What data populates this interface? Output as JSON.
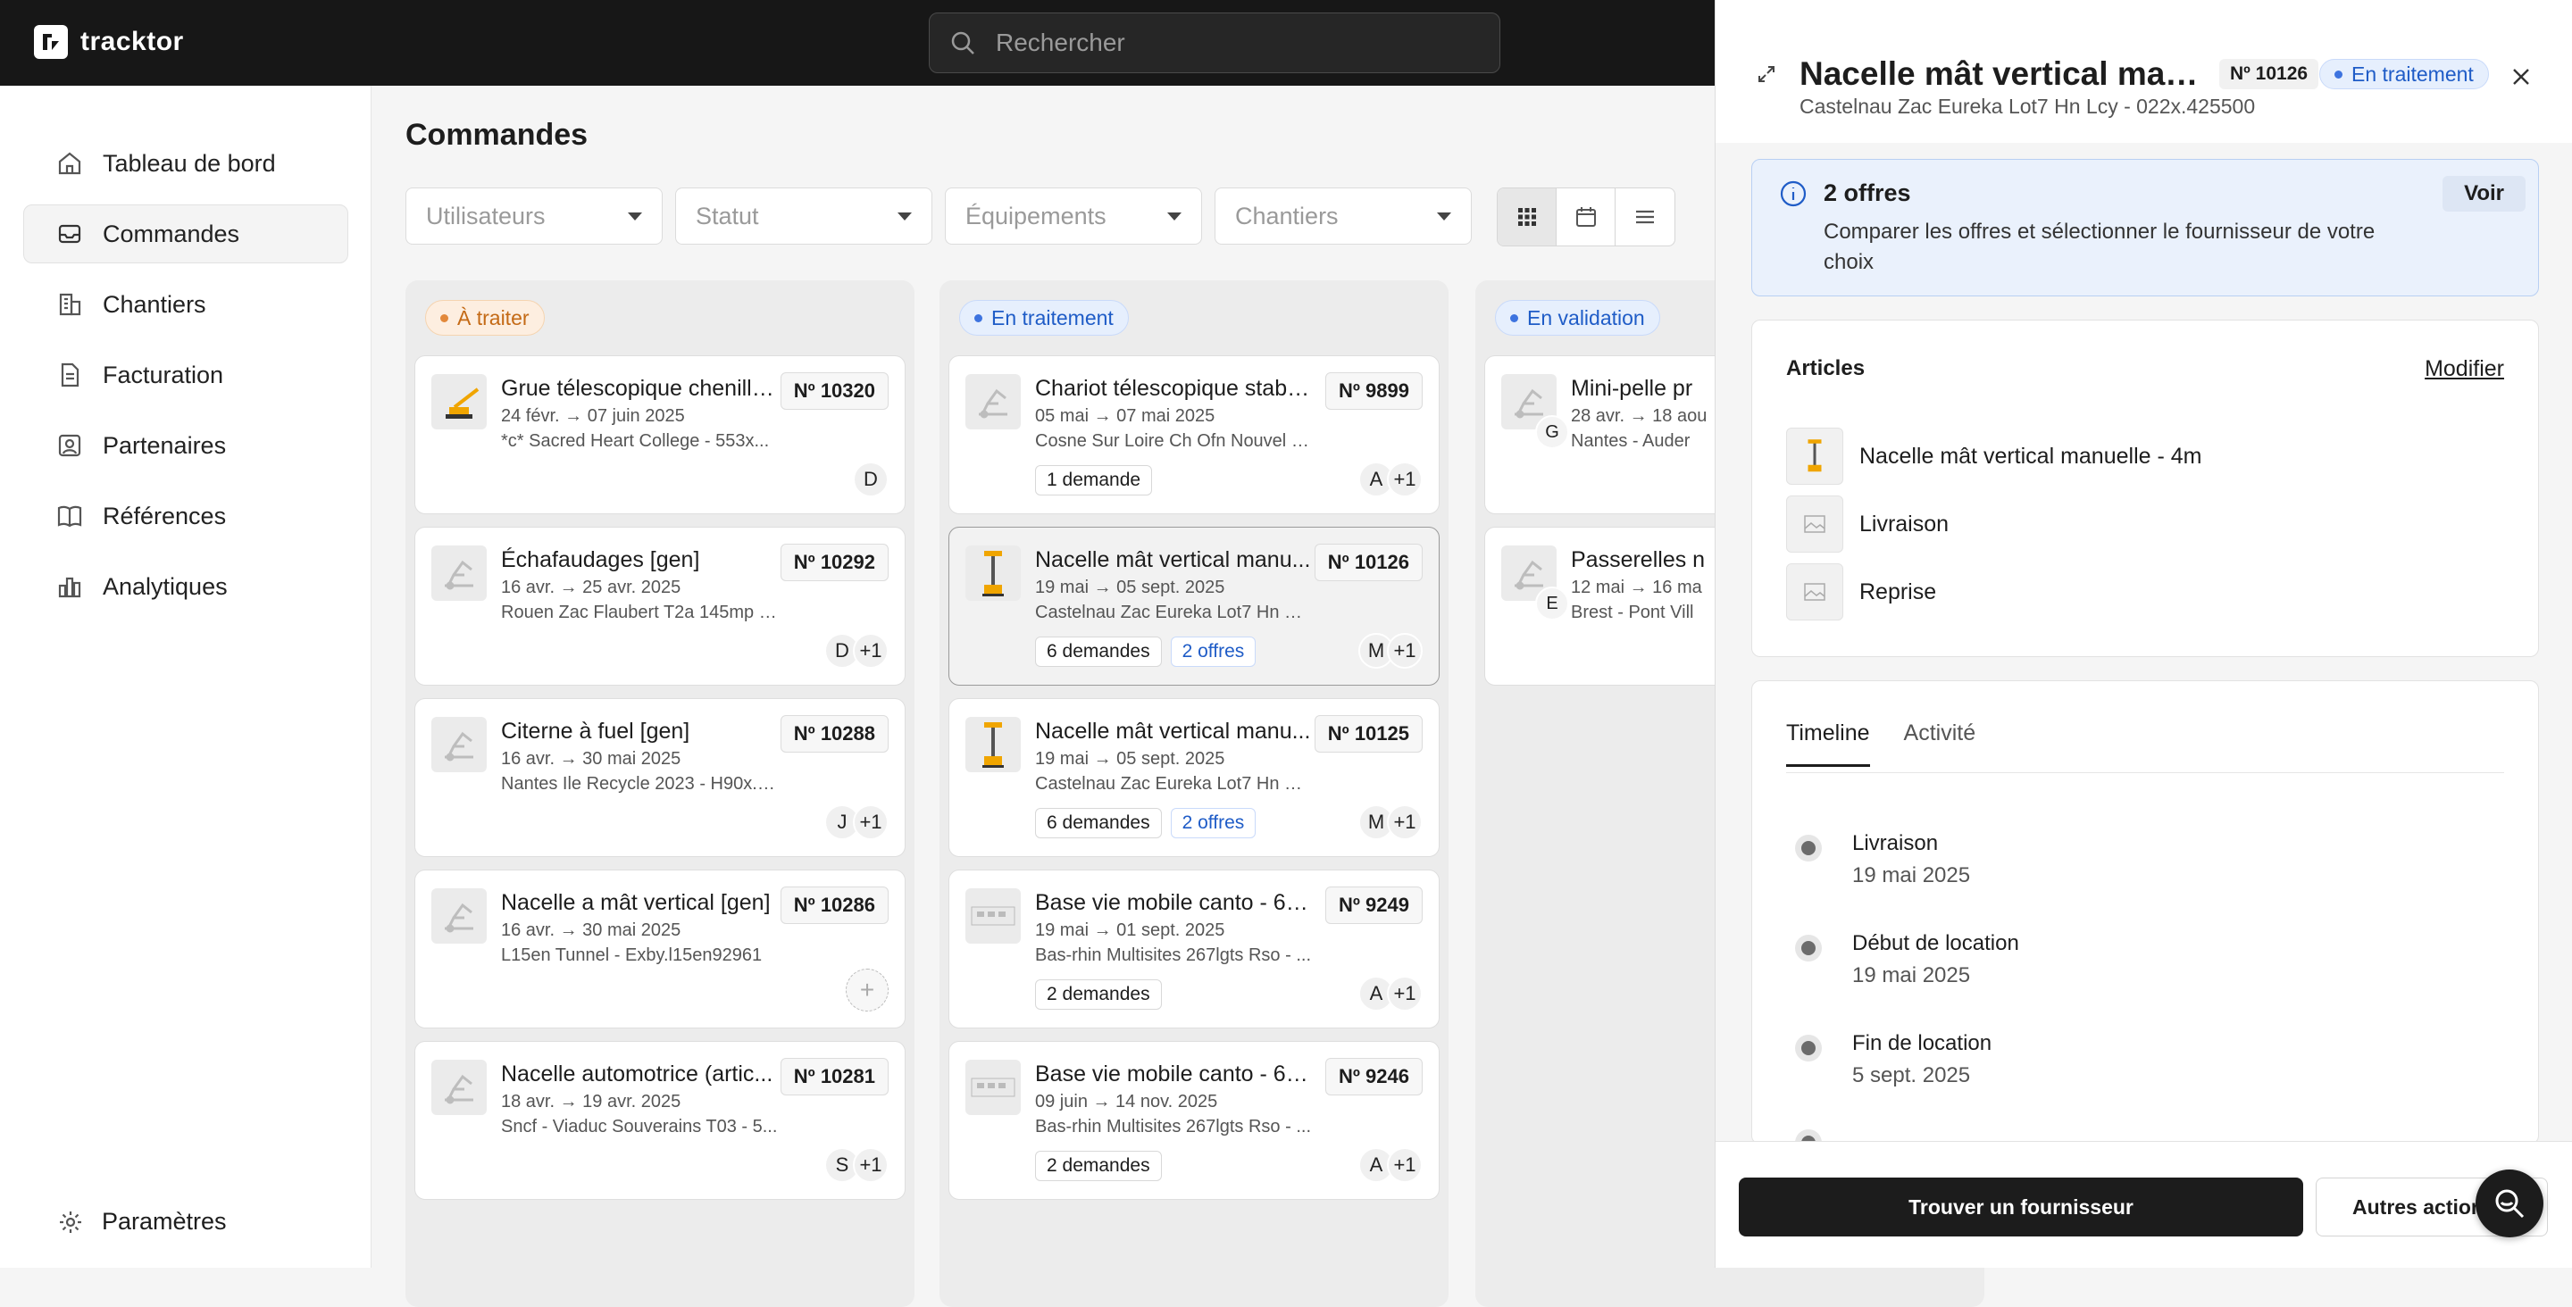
{
  "app": {
    "name": "tracktor"
  },
  "search": {
    "placeholder": "Rechercher"
  },
  "sidebar": {
    "items": [
      {
        "label": "Tableau de bord",
        "icon": "home-icon"
      },
      {
        "label": "Commandes",
        "icon": "inbox-icon",
        "active": true
      },
      {
        "label": "Chantiers",
        "icon": "building-icon"
      },
      {
        "label": "Facturation",
        "icon": "document-icon"
      },
      {
        "label": "Partenaires",
        "icon": "contact-icon"
      },
      {
        "label": "Références",
        "icon": "book-icon"
      },
      {
        "label": "Analytiques",
        "icon": "bar-chart-icon"
      }
    ],
    "settings_label": "Paramètres"
  },
  "main": {
    "title": "Commandes",
    "filters": [
      "Utilisateurs",
      "Statut",
      "Équipements",
      "Chantiers"
    ],
    "views": [
      "grid-view",
      "calendar-view",
      "list-view"
    ],
    "columns": [
      {
        "status": "À traiter",
        "cards": [
          {
            "title": "Grue télescopique chenille...",
            "num": "Nº 10320",
            "date": "24 févr. → 07 juin 2025",
            "site": "*c* Sacred Heart College - 553x...",
            "avatars": [
              "D"
            ]
          },
          {
            "title": "Échafaudages [gen]",
            "num": "Nº 10292",
            "date": "16 avr. → 25 avr. 2025",
            "site": "Rouen Zac Flaubert T2a 145mp L...",
            "avatars": [
              "D",
              "+1"
            ]
          },
          {
            "title": "Citerne à fuel [gen]",
            "num": "Nº 10288",
            "date": "16 avr. → 30 mai 2025",
            "site": "Nantes Ile Recycle 2023 - H90x.ir...",
            "avatars": [
              "J",
              "+1"
            ]
          },
          {
            "title": "Nacelle a mât vertical [gen]",
            "num": "Nº 10286",
            "date": "16 avr. → 30 mai 2025",
            "site": "L15en Tunnel - Exby.l15en92961",
            "avatars": [
              "+"
            ]
          },
          {
            "title": "Nacelle automotrice (artic...",
            "num": "Nº 10281",
            "date": "18 avr. → 19 avr. 2025",
            "site": "Sncf - Viaduc Souverains T03 - 5...",
            "avatars": [
              "S",
              "+1"
            ]
          }
        ]
      },
      {
        "status": "En traitement",
        "cards": [
          {
            "title": "Chariot télescopique stabili...",
            "num": "Nº 9899",
            "date": "05 mai → 07 mai 2025",
            "site": "Cosne Sur Loire Ch Ofn Nouvel H...",
            "tags": [
              "1 demande"
            ],
            "avatars": [
              "A",
              "+1"
            ]
          },
          {
            "title": "Nacelle mât vertical manu...",
            "num": "Nº 10126",
            "date": "19 mai → 05 sept. 2025",
            "site": "Castelnau Zac Eureka Lot7 Hn Lc...",
            "tags": [
              "6 demandes",
              "2 offres"
            ],
            "avatars": [
              "M",
              "+1"
            ],
            "selected": true
          },
          {
            "title": "Nacelle mât vertical manu...",
            "num": "Nº 10125",
            "date": "19 mai → 05 sept. 2025",
            "site": "Castelnau Zac Eureka Lot7 Hn Lc...",
            "tags": [
              "6 demandes",
              "2 offres"
            ],
            "avatars": [
              "M",
              "+1"
            ]
          },
          {
            "title": "Base vie mobile canto - 6 p...",
            "num": "Nº 9249",
            "date": "19 mai → 01 sept. 2025",
            "site": "Bas-rhin Multisites 267lgts Rso - ...",
            "tags": [
              "2 demandes"
            ],
            "avatars": [
              "A",
              "+1"
            ]
          },
          {
            "title": "Base vie mobile canto - 6 p...",
            "num": "Nº 9246",
            "date": "09 juin → 14 nov. 2025",
            "site": "Bas-rhin Multisites 267lgts Rso - ...",
            "tags": [
              "2 demandes"
            ],
            "avatars": [
              "A",
              "+1"
            ]
          }
        ]
      },
      {
        "status": "En validation",
        "cards": [
          {
            "title": "Mini-pelle pr",
            "date": "28 avr. → 18 aou",
            "site": "Nantes - Auder",
            "mini": "G"
          },
          {
            "title": "Passerelles n",
            "date": "12 mai → 16 ma",
            "site": "Brest - Pont Vill",
            "mini": "E"
          }
        ]
      }
    ]
  },
  "panel": {
    "title": "Nacelle mât vertical manu...",
    "num": "Nº 10126",
    "status": "En traitement",
    "subtitle": "Castelnau Zac Eureka Lot7 Hn Lcy - 022x.425500",
    "offers": {
      "title": "2 offres",
      "text": "Comparer les offres et sélectionner le fournisseur de votre choix",
      "button": "Voir"
    },
    "articles": {
      "title": "Articles",
      "edit": "Modifier",
      "items": [
        "Nacelle mât vertical manuelle - 4m",
        "Livraison",
        "Reprise"
      ]
    },
    "tabs": [
      "Timeline",
      "Activité"
    ],
    "timeline": [
      {
        "label": "Livraison",
        "date": "19 mai 2025"
      },
      {
        "label": "Début de location",
        "date": "19 mai 2025"
      },
      {
        "label": "Fin de location",
        "date": "5 sept. 2025"
      }
    ],
    "primary_button": "Trouver un fournisseur",
    "secondary_button": "Autres actions"
  },
  "colors": {
    "accent_blue": "#1f5cc7",
    "orange": "#c46a16",
    "dark": "#171717"
  }
}
